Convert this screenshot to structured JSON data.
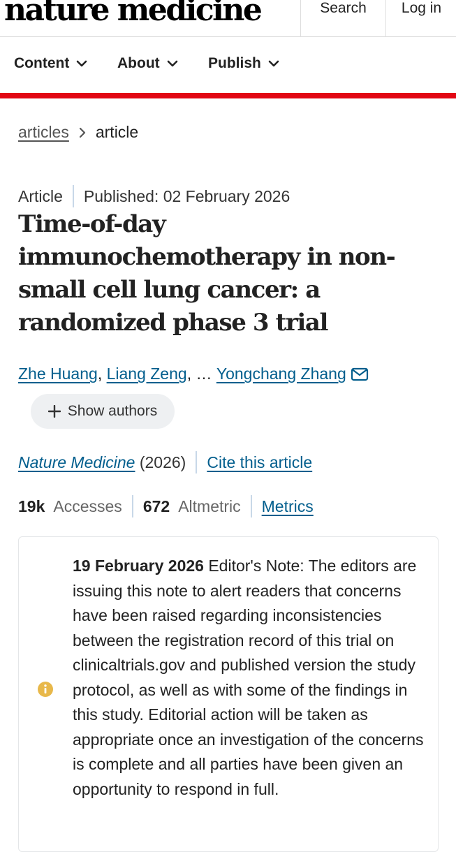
{
  "header": {
    "logo": "nature medicine",
    "search_label": "Search",
    "login_label": "Log in"
  },
  "nav": {
    "items": [
      {
        "label": "Content"
      },
      {
        "label": "About"
      },
      {
        "label": "Publish"
      }
    ]
  },
  "breadcrumb": {
    "parent": "articles",
    "current": "article"
  },
  "article": {
    "type": "Article",
    "published": "Published: 02 February 2026",
    "title": "Time-of-day immunochemotherapy in non-small cell lung cancer: a randomized phase 3 trial",
    "authors": [
      "Zhe Huang",
      "Liang Zeng",
      "Yongchang Zhang"
    ],
    "authors_separator": ",",
    "authors_ellipsis": "…",
    "show_authors_label": "Show authors",
    "journal": "Nature Medicine",
    "year": "(2026)",
    "cite_label": "Cite this article",
    "accesses_value": "19k",
    "accesses_label": "Accesses",
    "altmetric_value": "672",
    "altmetric_label": "Altmetric",
    "metrics_label": "Metrics"
  },
  "editor_note": {
    "date": "19 February 2026",
    "text": "Editor's Note: The editors are issuing this note to alert readers that concerns have been raised regarding inconsistencies between the registration record of this trial on clinicaltrials.gov and published version the study protocol, as well as with some of the findings in this study. Editorial action will be taken as appropriate once an investigation of the concerns is complete and all parties have been given an opportunity to respond in full.",
    "icon": "info-icon"
  },
  "colors": {
    "accent_red": "#e20714",
    "link_blue": "#025e8d",
    "info_yellow": "#e8b84a"
  }
}
